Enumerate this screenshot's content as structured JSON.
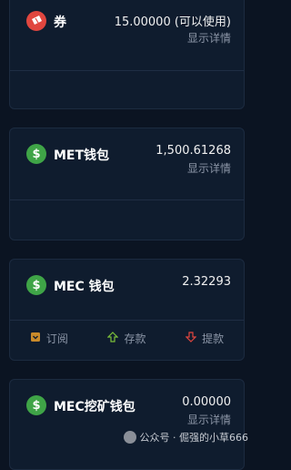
{
  "cards": [
    {
      "title": "券",
      "value": "15.00000 (可以使用)",
      "detail": "显示详情",
      "icon": "ticket-icon"
    },
    {
      "title": "MET钱包",
      "value": "1,500.61268",
      "detail": "显示详情",
      "icon": "dollar-icon"
    },
    {
      "title": "MEC 钱包",
      "value": "2.32293",
      "icon": "dollar-icon",
      "actions": [
        {
          "label": "订阅",
          "icon": "subscribe-icon"
        },
        {
          "label": "存款",
          "icon": "deposit-arrow-up-icon"
        },
        {
          "label": "提款",
          "icon": "withdraw-arrow-down-icon"
        }
      ]
    },
    {
      "title": "MEC挖矿钱包",
      "value": "0.00000",
      "detail": "显示详情",
      "icon": "dollar-icon"
    }
  ],
  "watermark": {
    "text": "公众号 · 倔强的小草666"
  },
  "colors": {
    "accent_green": "#3fa447",
    "accent_red": "#e0463f",
    "deposit_green": "#7bbf3a",
    "withdraw_red": "#e0463f",
    "subscribe_orange": "#c98a2a"
  }
}
